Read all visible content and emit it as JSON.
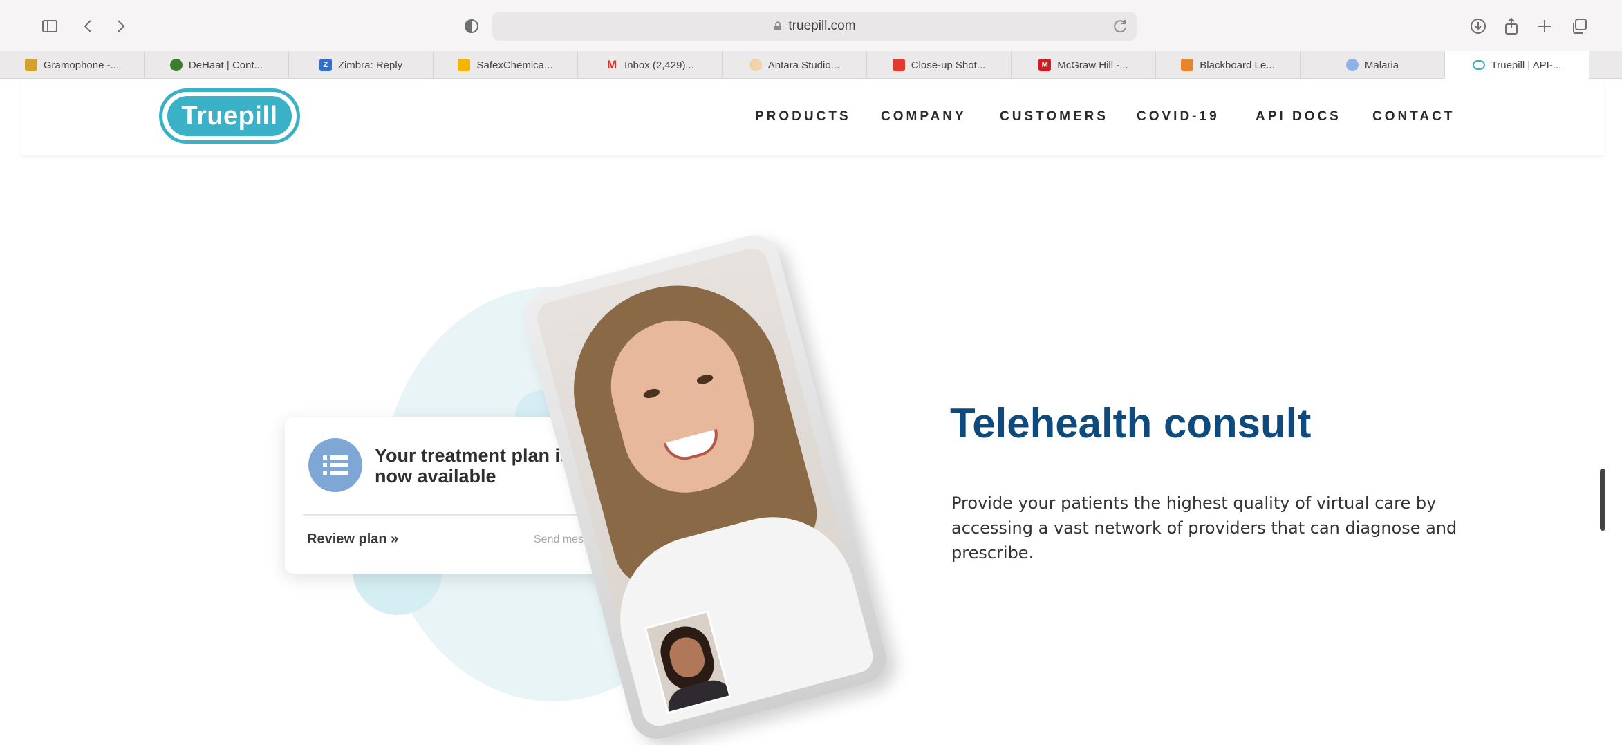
{
  "browser": {
    "url": "truepill.com",
    "tabs": [
      {
        "label": "Gramophone -...",
        "favicon_color": "#d4a22a"
      },
      {
        "label": "DeHaat | Cont...",
        "favicon_color": "#3a7d2b"
      },
      {
        "label": "Zimbra: Reply",
        "favicon_color": "#2f6fcf"
      },
      {
        "label": "SafexChemica...",
        "favicon_color": "#f4b400"
      },
      {
        "label": "Inbox (2,429)...",
        "favicon_color": "#d93025"
      },
      {
        "label": "Antara Studio...",
        "favicon_color": "#e0a060"
      },
      {
        "label": "Close-up Shot...",
        "favicon_color": "#e33a2d"
      },
      {
        "label": "McGraw Hill -...",
        "favicon_color": "#d71920"
      },
      {
        "label": "Blackboard Le...",
        "favicon_color": "#e8842c"
      },
      {
        "label": "Malaria",
        "favicon_color": "#5b8fd6"
      },
      {
        "label": "Truepill | API-...",
        "favicon_color": "#3bb1c8"
      }
    ],
    "favicon_glyphs": [
      "",
      "",
      "Z",
      "",
      "M",
      "",
      "",
      "M",
      "",
      "",
      ""
    ]
  },
  "site": {
    "logo_text": "Truepill",
    "nav": [
      {
        "label": "PRODUCTS"
      },
      {
        "label": "COMPANY"
      },
      {
        "label": "CUSTOMERS"
      },
      {
        "label": "COVID-19"
      },
      {
        "label": "API DOCS"
      },
      {
        "label": "CONTACT"
      }
    ]
  },
  "hero": {
    "card_title": "Your treatment plan is now available",
    "review_link": "Review plan »",
    "send_message": "Send message",
    "headline": "Telehealth consult",
    "body": "Provide your patients the highest quality of virtual care by accessing a vast network of providers that can diagnose and prescribe."
  },
  "colors": {
    "brand_teal": "#3bb1c8",
    "headline_navy": "#0e4a7d"
  }
}
